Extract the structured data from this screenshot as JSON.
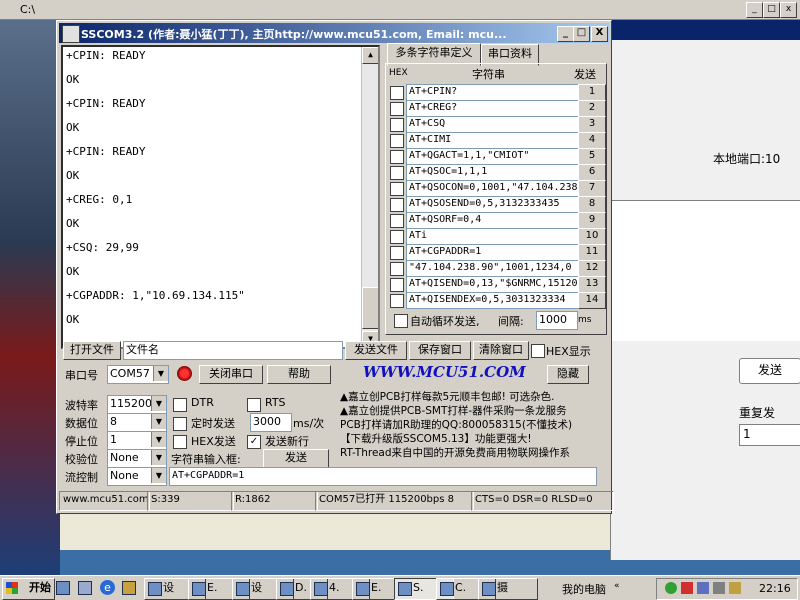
{
  "background": {
    "explorer_title": "C:\\",
    "right_panel": {
      "local_port_label": "本地端口:10",
      "send_button": "发送",
      "repeat_label": "重复发",
      "repeat_value": "1"
    }
  },
  "window": {
    "title": "SSCOM3.2 (作者:聂小猛(丁丁), 主页http://www.mcu51.com,  Email: mcu...",
    "minimize": "_",
    "maximize": "□",
    "close": "X"
  },
  "receive_lines": [
    "+CPIN: READY",
    "OK",
    "+CPIN: READY",
    "OK",
    "+CPIN: READY",
    "OK",
    "+CREG: 0,1",
    "OK",
    "+CSQ: 29,99",
    "OK",
    "+CGPADDR: 1,\"10.69.134.115\"",
    "OK"
  ],
  "tabs": [
    "多条字符串定义",
    "串口资料"
  ],
  "multi": {
    "col_hex": "HEX",
    "col_str": "字符串",
    "col_send": "发送",
    "rows": [
      {
        "cmd": "AT+CPIN?",
        "num": "1"
      },
      {
        "cmd": "AT+CREG?",
        "num": "2"
      },
      {
        "cmd": "AT+CSQ",
        "num": "3"
      },
      {
        "cmd": "AT+CIMI",
        "num": "4"
      },
      {
        "cmd": "AT+QGACT=1,1,\"CMIOT\"",
        "num": "5"
      },
      {
        "cmd": "AT+QSOC=1,1,1",
        "num": "6"
      },
      {
        "cmd": "AT+QSOCON=0,1001,\"47.104.238",
        "num": "7"
      },
      {
        "cmd": "AT+QSOSEND=0,5,3132333435",
        "num": "8"
      },
      {
        "cmd": "AT+QSORF=0,4",
        "num": "9"
      },
      {
        "cmd": "ATi",
        "num": "10"
      },
      {
        "cmd": "AT+CGPADDR=1",
        "num": "11"
      },
      {
        "cmd": "\"47.104.238.90\",1001,1234,0",
        "num": "12"
      },
      {
        "cmd": "AT+QISEND=0,13,\"$GNRMC,15120",
        "num": "13"
      },
      {
        "cmd": "AT+QISENDEX=0,5,3031323334",
        "num": "14"
      }
    ],
    "loop_label": "自动循环发送,",
    "interval_label": "间隔:",
    "interval_value": "1000",
    "interval_unit": "ms"
  },
  "controls": {
    "open_file": "打开文件",
    "filename": "文件名",
    "send_file": "发送文件",
    "save_window": "保存窗口",
    "clear_window": "清除窗口",
    "hex_display": "HEX显示",
    "port_label": "串口号",
    "port_value": "COM57",
    "close_port": "关闭串口",
    "help": "帮助",
    "brand": "WWW.MCU51.COM",
    "hide": "隐藏",
    "baud_label": "波特率",
    "baud_value": "115200",
    "databits_label": "数据位",
    "databits_value": "8",
    "stopbits_label": "停止位",
    "stopbits_value": "1",
    "parity_label": "校验位",
    "parity_value": "None",
    "flow_label": "流控制",
    "flow_value": "None",
    "dtr": "DTR",
    "rts": "RTS",
    "timed_send": "定时发送",
    "timed_value": "3000",
    "timed_unit": "ms/次",
    "hex_send": "HEX发送",
    "send_newline": "发送新行",
    "input_label": "字符串输入框:",
    "send": "发送",
    "input_value": "AT+CGPADDR=1"
  },
  "info_lines": [
    "▲嘉立创PCB打样每款5元顺丰包邮! 可选杂色.",
    "▲嘉立创提供PCB-SMT打样-器件采购一条龙服务",
    "PCB打样请加R助理的QQ:800058315(不懂技术)",
    "【下载升级版SSCOM5.13】功能更强大!",
    "RT-Thread来自中国的开源免费商用物联网操作系"
  ],
  "status": {
    "site": "www.mcu51.com",
    "s": "S:339",
    "r": "R:1862",
    "port": "COM57已打开  115200bps  8",
    "lines": "CTS=0 DSR=0 RLSD=0"
  },
  "taskbar": {
    "start": "开始",
    "items": [
      "设",
      "E.",
      "设",
      "D.",
      "4.",
      "E.",
      "S.",
      "C.",
      "摄"
    ],
    "my_computer": "我的电脑",
    "time": "22:16"
  }
}
